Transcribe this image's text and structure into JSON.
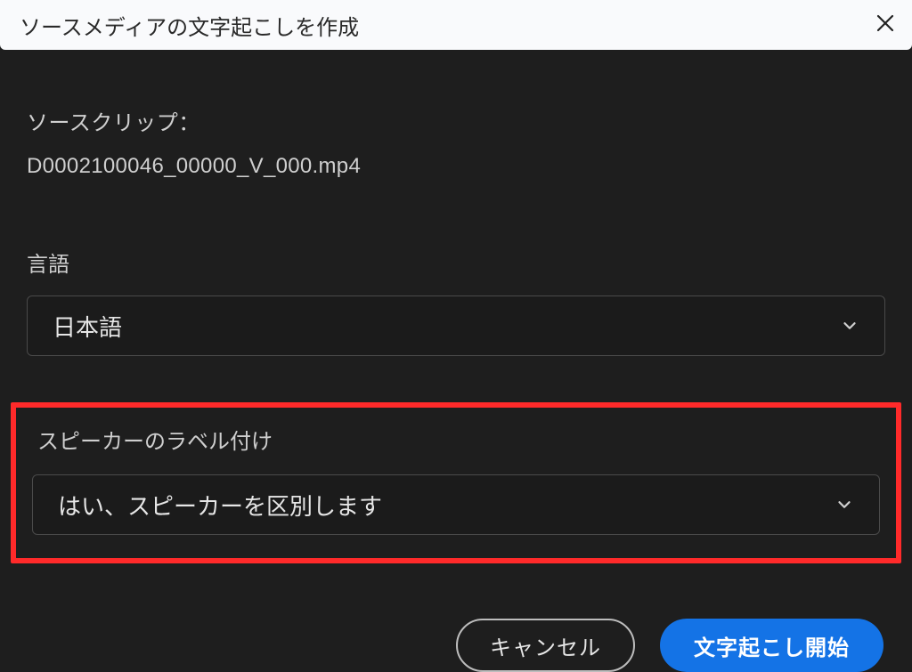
{
  "dialog": {
    "title": "ソースメディアの文字起こしを作成"
  },
  "source": {
    "label": "ソースクリップ：",
    "filename": "D0002100046_00000_V_000.mp4"
  },
  "language": {
    "label": "言語",
    "value": "日本語"
  },
  "speaker": {
    "label": "スピーカーのラベル付け",
    "value": "はい、スピーカーを区別します"
  },
  "buttons": {
    "cancel": "キャンセル",
    "start": "文字起こし開始"
  }
}
